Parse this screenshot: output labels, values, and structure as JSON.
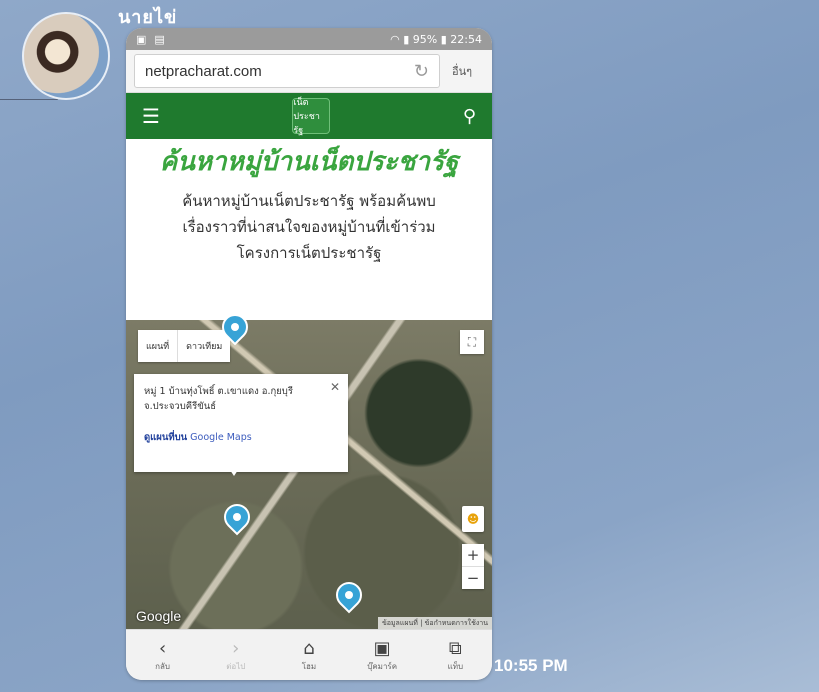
{
  "chat": {
    "sender_name": "นายไข่",
    "timestamp": "10:55 PM"
  },
  "phone": {
    "status": {
      "battery": "95%",
      "time": "22:54"
    },
    "browser": {
      "url": "netpracharat.com",
      "more_label": "อื่นๆ"
    },
    "site": {
      "title": "ค้นหาหมู่บ้านเน็ตประชารัฐ",
      "description_lines": [
        "ค้นหาหมู่บ้านเน็ตประชารัฐ พร้อมค้นพบ",
        "เรื่องราวที่น่าสนใจของหมู่บ้านที่เข้าร่วม",
        "โครงการเน็ตประชารัฐ"
      ],
      "logo_text": "เน็ตประชารัฐ"
    },
    "map": {
      "map_type_options": [
        "แผนที่",
        "ดาวเทียม"
      ],
      "info_address": "หมู่ 1 บ้านทุ่งโพธิ์ ต.เขาแดง อ.กุยบุรี จ.ประจวบคีรีขันธ์",
      "info_link_prefix": "ดูแผนที่บน",
      "info_link_brand": "Google Maps",
      "google_logo": "Google",
      "attribution": "ข้อมูลแผนที่ | ข้อกำหนดการใช้งาน"
    },
    "bottom_nav": [
      {
        "icon": "back-icon",
        "glyph": "‹",
        "label": "กลับ"
      },
      {
        "icon": "forward-icon",
        "glyph": "›",
        "label": "ต่อไป"
      },
      {
        "icon": "home-icon",
        "glyph": "⌂",
        "label": "โฮม"
      },
      {
        "icon": "bookmark-icon",
        "glyph": "▣",
        "label": "บุ๊คมาร์ค"
      },
      {
        "icon": "tabs-icon",
        "glyph": "⧉",
        "label": "แท็บ"
      }
    ]
  }
}
